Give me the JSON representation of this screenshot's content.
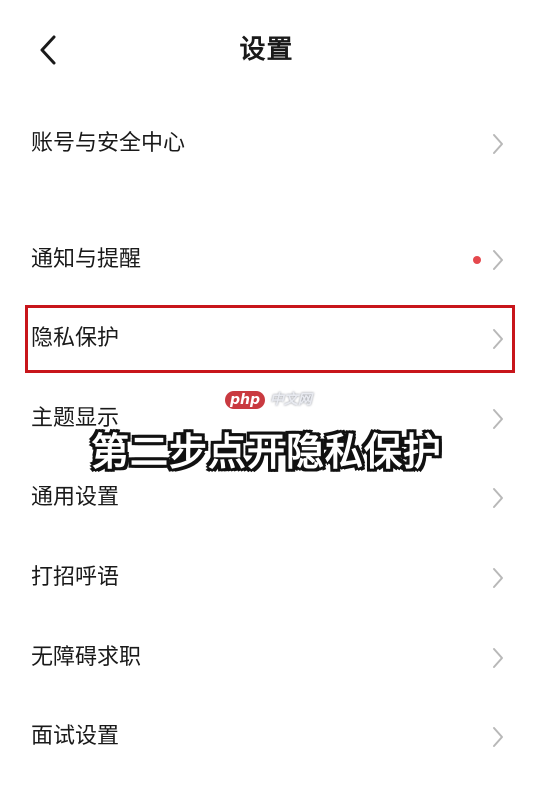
{
  "header": {
    "title": "设置",
    "back_icon": "chevron-left-icon"
  },
  "settings": {
    "items": [
      {
        "label": "账号与安全中心",
        "badge": false
      },
      {
        "label": "通知与提醒",
        "badge": true
      },
      {
        "label": "隐私保护",
        "badge": false,
        "highlighted": true
      },
      {
        "label": "主题显示",
        "badge": false
      },
      {
        "label": "通用设置",
        "badge": false
      },
      {
        "label": "打招呼语",
        "badge": false
      },
      {
        "label": "无障碍求职",
        "badge": false
      },
      {
        "label": "面试设置",
        "badge": false
      }
    ]
  },
  "overlay": {
    "caption": "第二步点开隐私保护",
    "watermark_php": "php",
    "watermark_cn": "中文网"
  },
  "colors": {
    "highlight_border": "#c8151b",
    "badge_dot": "#e5484d",
    "chevron": "#b8b8b8",
    "text": "#1a1a1a",
    "background": "#ffffff"
  }
}
